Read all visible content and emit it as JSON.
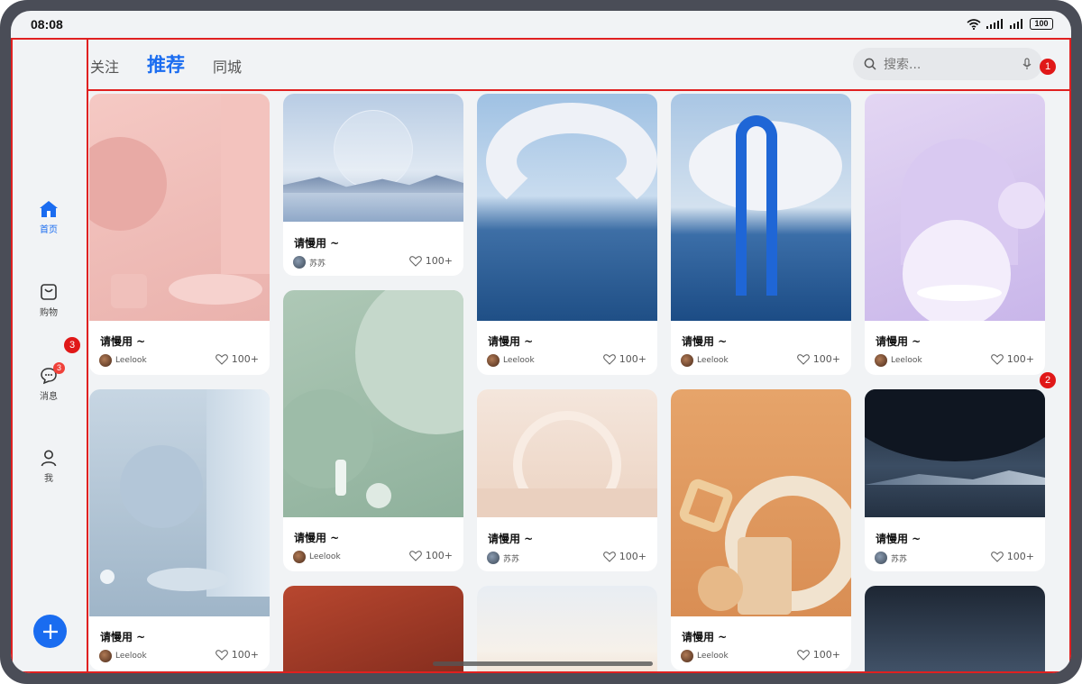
{
  "status": {
    "time": "08:08",
    "battery": "100"
  },
  "sidebar": {
    "items": [
      {
        "label": "首页",
        "icon": "home-icon",
        "active": true
      },
      {
        "label": "购物",
        "icon": "shopping-bag-icon",
        "active": false
      },
      {
        "label": "消息",
        "icon": "message-icon",
        "active": false,
        "badge": "3"
      },
      {
        "label": "我",
        "icon": "user-icon",
        "active": false
      }
    ],
    "fab_icon": "plus-icon"
  },
  "topbar": {
    "tabs": [
      {
        "label": "关注",
        "active": false
      },
      {
        "label": "推荐",
        "active": true
      },
      {
        "label": "同城",
        "active": false
      }
    ],
    "search": {
      "placeholder": "搜索..."
    }
  },
  "annotations": {
    "box1": "1",
    "box2": "2",
    "box3": "3"
  },
  "colors": {
    "accent": "#1a6cf0",
    "badge": "#f0413a",
    "outline": "#e02020"
  },
  "cards": [
    {
      "title": "请慢用 ~",
      "author": "Leelook",
      "likes": "100+"
    },
    {
      "title": "请慢用 ~",
      "author": "Leelook",
      "likes": "100+"
    },
    {
      "title": "请慢用 ~",
      "author": "苏苏",
      "likes": "100+"
    },
    {
      "title": "请慢用 ~",
      "author": "Leelook",
      "likes": "100+"
    },
    {
      "title": "请慢用 ~",
      "author": "Leelook",
      "likes": "100+"
    },
    {
      "title": "请慢用 ~",
      "author": "苏苏",
      "likes": "100+"
    },
    {
      "title": "请慢用 ~",
      "author": "Leelook",
      "likes": "100+"
    },
    {
      "title": "请慢用 ~",
      "author": "Leelook",
      "likes": "100+"
    },
    {
      "title": "请慢用 ~",
      "author": "Leelook",
      "likes": "100+"
    },
    {
      "title": "请慢用 ~",
      "author": "苏苏",
      "likes": "100+"
    }
  ]
}
